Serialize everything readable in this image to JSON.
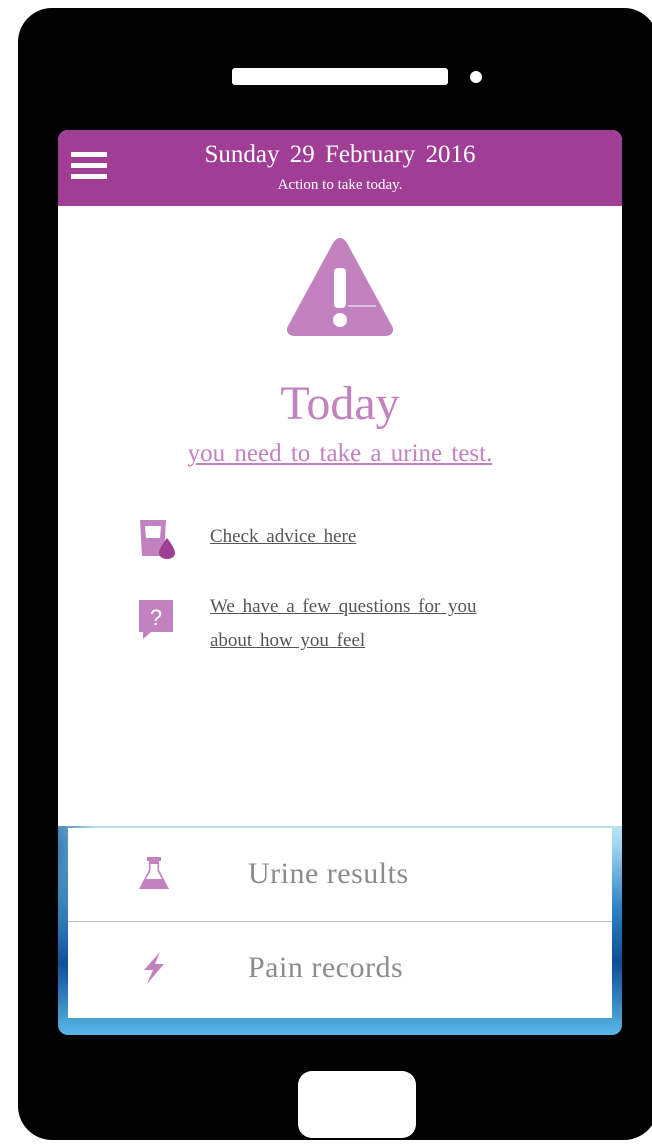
{
  "header": {
    "date": "Sunday 29 February 2016",
    "subtitle": "Action to take today."
  },
  "main": {
    "title": "Today",
    "action_text": "you need to take a urine test.",
    "links": [
      {
        "label": "Check advice here",
        "icon": "cup-drop-icon"
      },
      {
        "label_line1": "We have a few questions for you",
        "label_line2": "about how you feel",
        "icon": "question-icon"
      }
    ]
  },
  "bottom_nav": {
    "items": [
      {
        "label": "Urine results",
        "icon": "flask-icon"
      },
      {
        "label": "Pain records",
        "icon": "lightning-icon"
      }
    ]
  },
  "colors": {
    "brand": "#a03e95",
    "accent_light": "#c282bf",
    "link_text": "#555555",
    "nav_text": "#8c8c8c",
    "device": "#020202"
  }
}
